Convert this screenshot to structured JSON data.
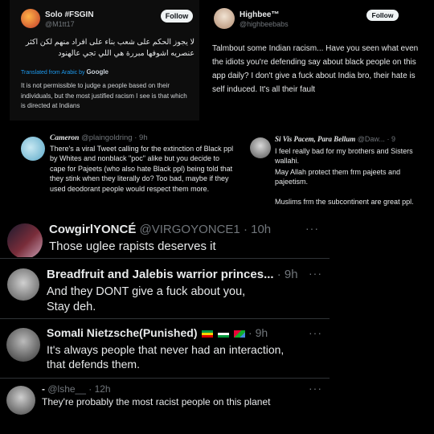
{
  "tweet1": {
    "name": "Solo #FSGIN",
    "handle": "@M1tt17",
    "follow": "Follow",
    "arabic_line1": "لا يجوز الحكم على شعب بناء على افراد منهم لكن اكثر",
    "arabic_line2": "عنصريه اشوفها مبررة هي اللي تجي عالهنود",
    "translated_label": "Translated from Arabic by",
    "google": "Google",
    "translation": "It is not permissible to judge a people based on their individuals, but the most justified racism I see is that which is directed at Indians"
  },
  "tweet2": {
    "name": "Highbee™",
    "handle": "@highbeebabs",
    "follow": "Follow",
    "text": "Talmbout some Indian racism... Have you seen what even the idiots you're defending say about black people on this app daily? I don't give a fuck about India bro, their hate is self induced. It's all their fault"
  },
  "tweet3": {
    "name": "Cameron",
    "handle": "@plaingoldring",
    "time": "· 9h",
    "text": "There's a viral Tweet calling for the extinction of Black ppl by Whites and nonblack \"poc\" alike but you decide to cape for Pajeets (who also hate Black ppl) being told that they stink when they literally do? Too bad, maybe if they used deodorant people would respect them more."
  },
  "tweet4": {
    "name": "Si Vis Pacem, Para Bellum",
    "handle": "@Daw...",
    "time": "· 9",
    "line1": "I feel really bad for my brothers and Sisters wallahi.",
    "line2": "May Allah protect them frm pajeets and pajeetism.",
    "line3": "Muslims frm the subcontinent are great ppl."
  },
  "tweet5": {
    "name": "CowgirlYONCÉ",
    "handle": "@VIRGOYONCE1",
    "time": "· 10h",
    "text": "Those uglee rapists deserves it"
  },
  "tweet6": {
    "name": "Breadfruit and Jalebis warrior princes...",
    "time": "· 9h",
    "line1": "And they DONT give a fuck about you,",
    "line2": "Stay deh."
  },
  "tweet7": {
    "name": "Somali Nietzsche(Punished)",
    "time": "· 9h",
    "line1": "It's always people that never had an interaction,",
    "line2": "that defends them."
  },
  "tweet8": {
    "name": "-",
    "handle": "@lshe__",
    "time": "· 12h",
    "text": "They're probably the most racist people on this planet"
  },
  "colors": {
    "background": "#000000",
    "muted": "#71767b",
    "text": "#e7e9ea",
    "link": "#1d9bf0"
  }
}
